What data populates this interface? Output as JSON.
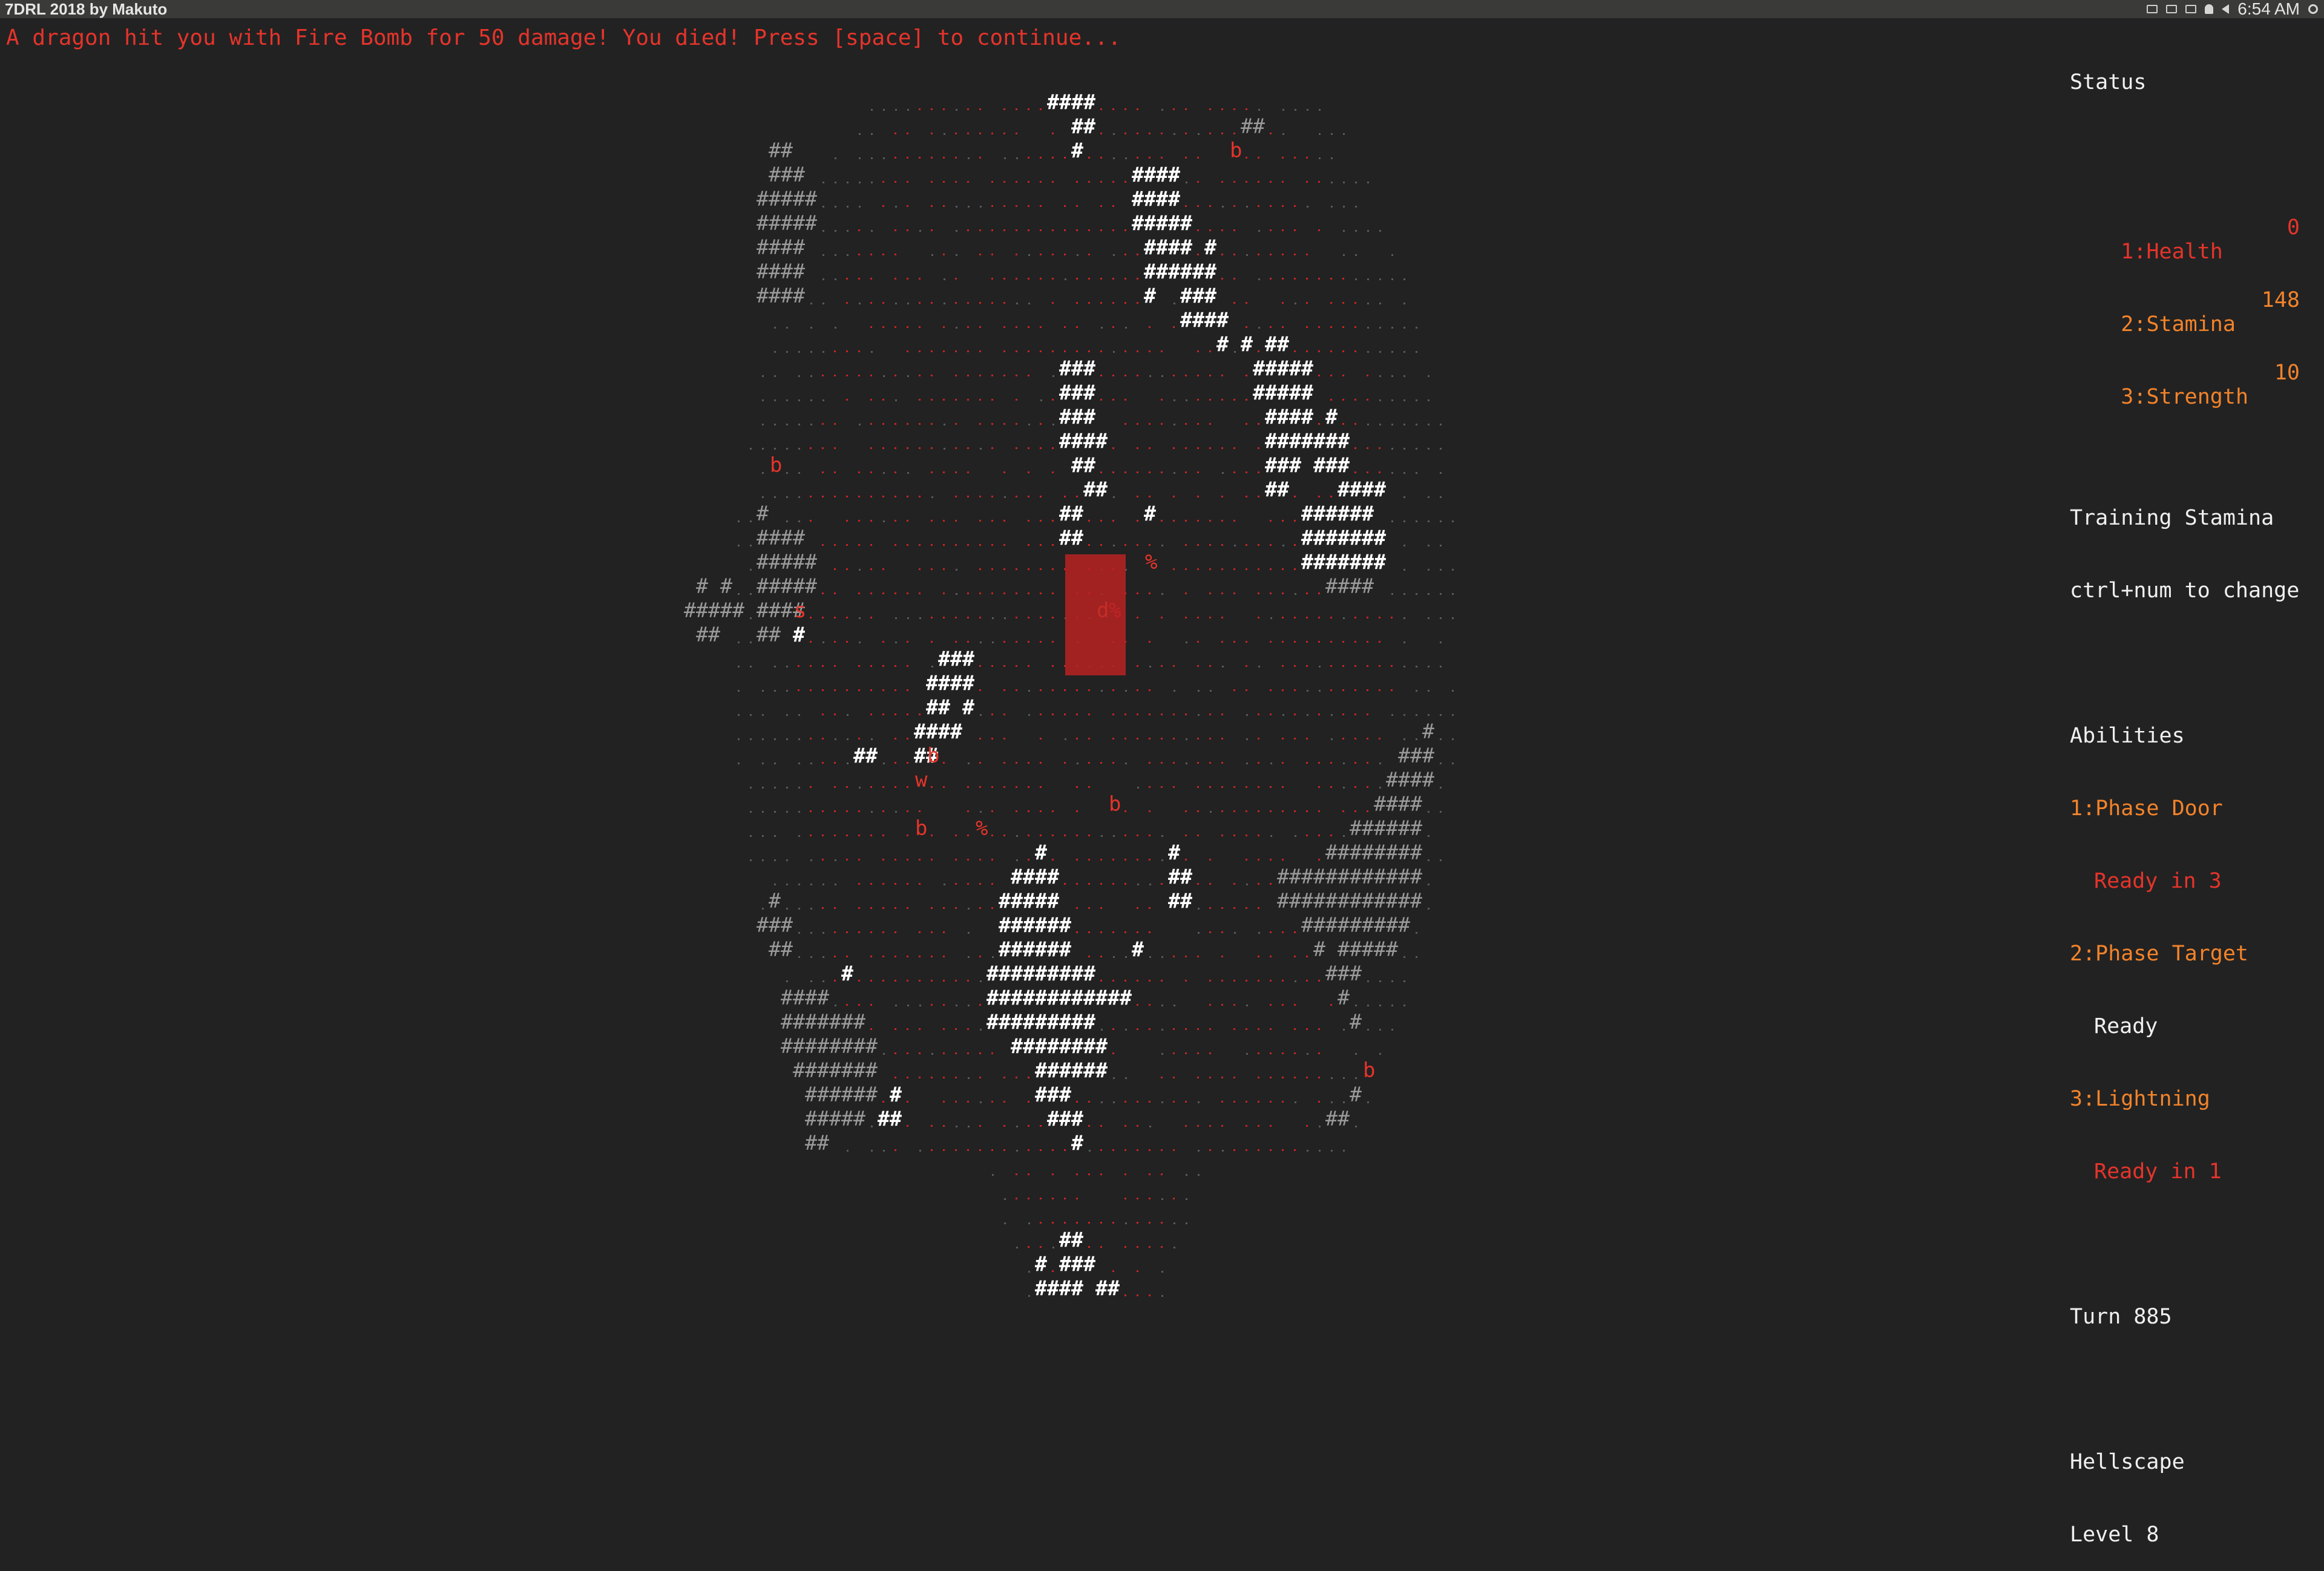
{
  "window": {
    "title": "7DRL 2018 by Makuto"
  },
  "tray": {
    "clock": "6:54 AM",
    "icons": [
      "box-icon",
      "window-icon",
      "keyboard-icon",
      "bell-icon",
      "speaker-icon",
      "gear-icon"
    ]
  },
  "message": "A dragon hit you with Fire Bomb for 50 damage! You died! Press [space] to continue...",
  "colors": {
    "background": "#222222",
    "wall_lit": "#ffffff",
    "wall_dim": "#9a9a9a",
    "floor_red": "#c42525",
    "floor_dim": "#5a5a5a",
    "monster": "#e5342b",
    "target": "#b82222"
  },
  "status": {
    "heading": "Status",
    "stats": [
      {
        "label": "1:Health",
        "value": "0"
      },
      {
        "label": "2:Stamina",
        "value": "148"
      },
      {
        "label": "3:Strength",
        "value": "10"
      }
    ],
    "training_line1": "Training Stamina",
    "training_line2": "ctrl+num to change",
    "abilities_heading": "Abilities",
    "abilities": [
      {
        "name": "1:Phase Door",
        "state": "Ready in 3"
      },
      {
        "name": "2:Phase Target",
        "state": "Ready"
      },
      {
        "name": "3:Lightning",
        "state": "Ready in 1"
      }
    ],
    "turn": "Turn 885",
    "area": "Hellscape",
    "level": "Level 8"
  },
  "entities": [
    {
      "glyph": "b",
      "kind": "monster"
    },
    {
      "glyph": "b",
      "kind": "monster"
    },
    {
      "glyph": "%",
      "kind": "item"
    },
    {
      "glyph": "d",
      "kind": "dragon"
    },
    {
      "glyph": "%",
      "kind": "item"
    },
    {
      "glyph": "s",
      "kind": "monster"
    },
    {
      "glyph": "b",
      "kind": "monster"
    },
    {
      "glyph": "w",
      "kind": "monster"
    },
    {
      "glyph": "b",
      "kind": "monster"
    },
    {
      "glyph": "b",
      "kind": "monster"
    },
    {
      "glyph": "%",
      "kind": "item"
    },
    {
      "glyph": "b",
      "kind": "monster"
    }
  ]
}
